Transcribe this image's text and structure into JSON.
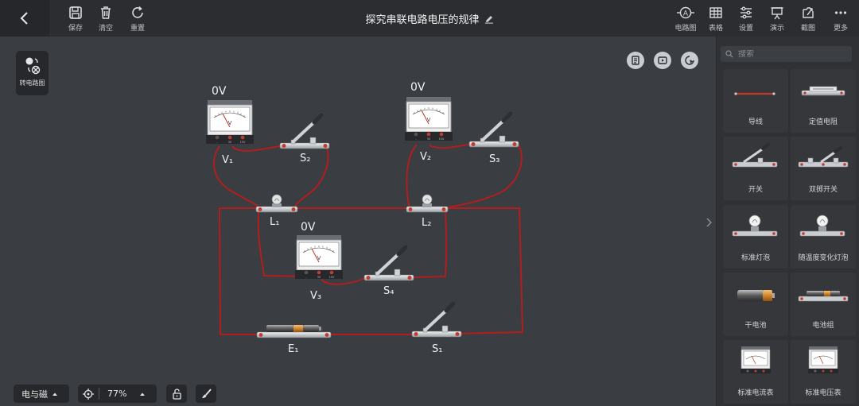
{
  "header": {
    "title": "探究串联电路电压的规律",
    "left_tools": [
      {
        "label": "保存",
        "icon": "save-icon"
      },
      {
        "label": "清空",
        "icon": "trash-icon"
      },
      {
        "label": "重置",
        "icon": "reset-icon"
      }
    ],
    "right_tools": [
      {
        "label": "电路图",
        "icon": "circuit-diagram-icon"
      },
      {
        "label": "表格",
        "icon": "table-icon"
      },
      {
        "label": "设置",
        "icon": "settings-icon"
      },
      {
        "label": "演示",
        "icon": "present-icon"
      },
      {
        "label": "截图",
        "icon": "screenshot-icon"
      },
      {
        "label": "更多",
        "icon": "more-icon"
      }
    ]
  },
  "canvas": {
    "convert_label": "转电路图",
    "components": {
      "v1": {
        "reading": "0V",
        "label": "V₁"
      },
      "v2": {
        "reading": "0V",
        "label": "V₂"
      },
      "v3": {
        "reading": "0V",
        "label": "V₃"
      },
      "s1": "S₁",
      "s2": "S₂",
      "s3": "S₃",
      "s4": "S₄",
      "l1": "L₁",
      "l2": "L₂",
      "e1": "E₁"
    },
    "meter_scale": {
      "unit": "V",
      "terminals": [
        "-",
        "3V",
        "15V"
      ]
    },
    "colors": {
      "wire": "#b21e1e",
      "background": "#3a3d42"
    }
  },
  "bottom": {
    "mode": "电与磁",
    "zoom": "77%"
  },
  "panel": {
    "search_placeholder": "搜索",
    "items": [
      {
        "label": "导线"
      },
      {
        "label": "定值电阻"
      },
      {
        "label": "开关"
      },
      {
        "label": "双掷开关"
      },
      {
        "label": "标准灯泡"
      },
      {
        "label": "随温度变化灯泡"
      },
      {
        "label": "干电池"
      },
      {
        "label": "电池组"
      },
      {
        "label": "标准电流表"
      },
      {
        "label": "标准电压表"
      }
    ]
  }
}
